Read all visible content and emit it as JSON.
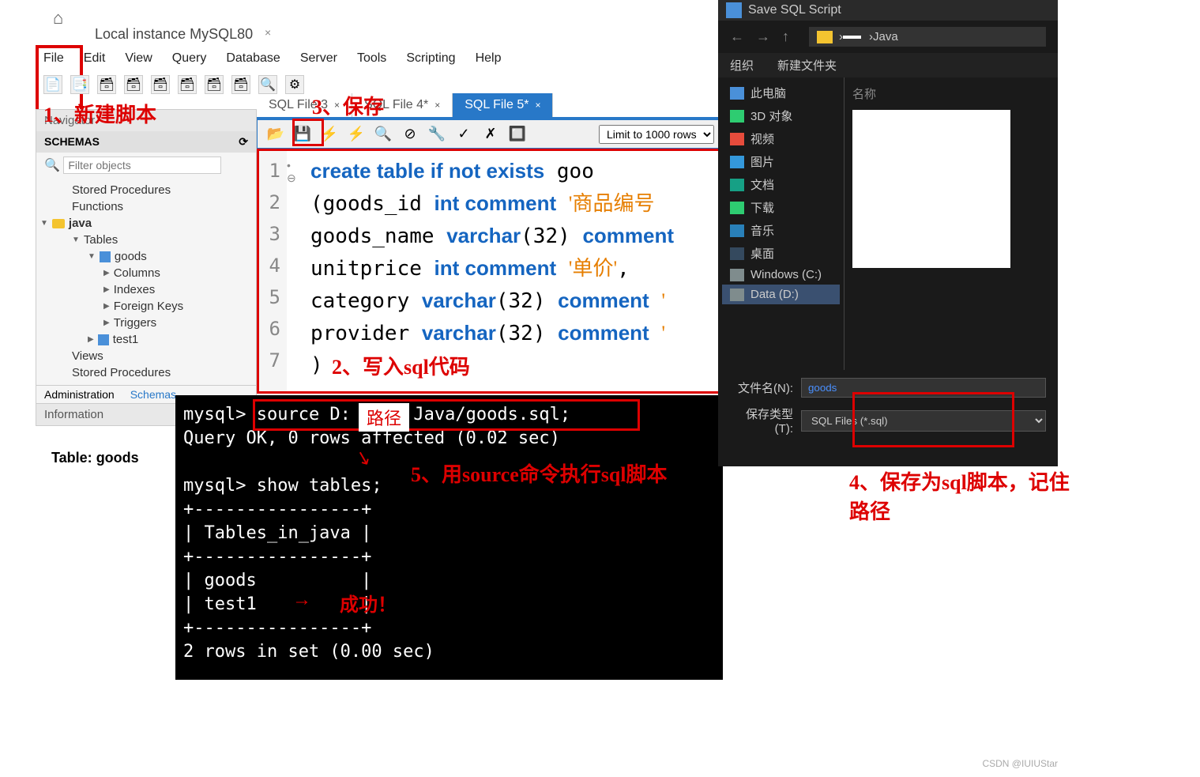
{
  "app": {
    "instance_tab": "Local instance MySQL80",
    "menus": [
      "File",
      "Edit",
      "View",
      "Query",
      "Database",
      "Server",
      "Tools",
      "Scripting",
      "Help"
    ]
  },
  "navigator": {
    "title": "Navigator",
    "schemas_label": "SCHEMAS",
    "filter_placeholder": "Filter objects",
    "tree": {
      "stored_procs": "Stored Procedures",
      "functions": "Functions",
      "db": "java",
      "tables": "Tables",
      "table1": "goods",
      "columns": "Columns",
      "indexes": "Indexes",
      "foreign_keys": "Foreign Keys",
      "triggers": "Triggers",
      "table2": "test1",
      "views": "Views",
      "stored_procs2": "Stored Procedures"
    },
    "bottom_tabs": [
      "Administration",
      "Schemas"
    ],
    "info_label": "Information",
    "info_prefix": "Table:",
    "info_value": "goods"
  },
  "editor": {
    "tabs": [
      "SQL File 3",
      "SQL File 4*",
      "SQL File 5*"
    ],
    "limit": "Limit to 1000 rows",
    "code_lines": [
      "create table if not exists goo",
      "(goods_id int comment '商品编号",
      "goods_name varchar(32) comment",
      "unitprice int comment '单价',",
      "category varchar(32) comment '",
      "provider varchar(32) comment '",
      ")"
    ]
  },
  "terminal": {
    "line1": "mysql> source D:      Java/goods.sql;",
    "line2": "Query OK, 0 rows affected (0.02 sec)",
    "line3": "mysql> show tables;",
    "line4": "+----------------+",
    "line5": "| Tables_in_java |",
    "line6": "+----------------+",
    "line7": "| goods          |",
    "line8": "| test1          |",
    "line9": "+----------------+",
    "line10": "2 rows in set (0.00 sec)"
  },
  "save_dialog": {
    "title": "Save SQL Script",
    "breadcrumb": "Java",
    "organize": "组织",
    "new_folder": "新建文件夹",
    "name_col": "名称",
    "sidebar": {
      "this_pc": "此电脑",
      "items": [
        "3D 对象",
        "视频",
        "图片",
        "文档",
        "下载",
        "音乐",
        "桌面",
        "Windows (C:)",
        "Data (D:)"
      ]
    },
    "filename_label": "文件名(N):",
    "filename_value": "goods",
    "filetype_label": "保存类型(T):",
    "filetype_value": "SQL Files (*.sql)"
  },
  "annotations": {
    "a1": "1、新建脚本",
    "a2": "2、写入sql代码",
    "a3": "3、保存",
    "a4": "4、保存为sql脚本，记住路径",
    "a5": "5、用source命令执行sql脚本",
    "success": "成功！",
    "path_label": "路径"
  },
  "watermark": "CSDN @IUIUStar"
}
